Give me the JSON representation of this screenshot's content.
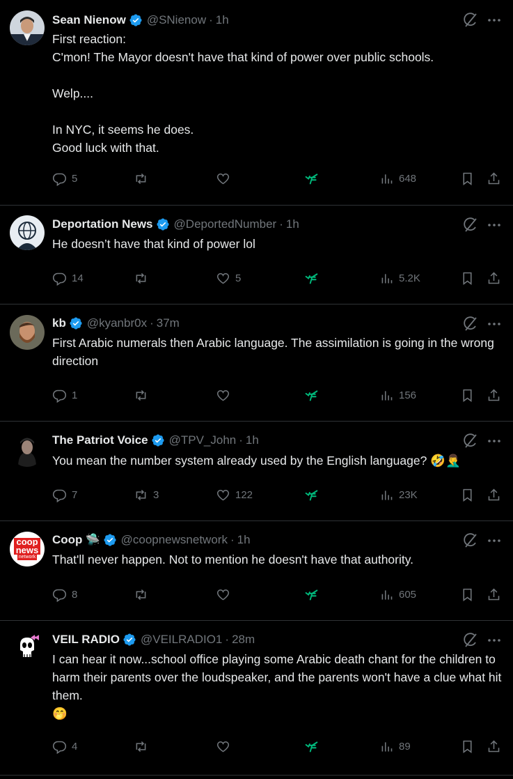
{
  "tweets": [
    {
      "name": "Sean Nienow",
      "handle": "@SNienow",
      "time": "1h",
      "text": "First reaction:\nC'mon! The Mayor doesn't have that kind of power over public schools.\n\nWelp....\n\nIn NYC, it seems he does.\nGood luck with that.",
      "replies": "5",
      "reposts": "",
      "likes": "",
      "views": "648",
      "name_emoji": ""
    },
    {
      "name": "Deportation News",
      "handle": "@DeportedNumber",
      "time": "1h",
      "text": "He doesn’t have that kind of power lol",
      "replies": "14",
      "reposts": "",
      "likes": "5",
      "views": "5.2K",
      "name_emoji": ""
    },
    {
      "name": "kb",
      "handle": "@kyanbr0x",
      "time": "37m",
      "text": "First Arabic numerals then Arabic language. The assimilation is going in the wrong direction",
      "replies": "1",
      "reposts": "",
      "likes": "",
      "views": "156",
      "name_emoji": ""
    },
    {
      "name": "The Patriot Voice",
      "handle": "@TPV_John",
      "time": "1h",
      "text": "You mean the number system already used by the English language? 🤣🤦‍♂️",
      "replies": "7",
      "reposts": "3",
      "likes": "122",
      "views": "23K",
      "name_emoji": ""
    },
    {
      "name": "Coop",
      "handle": "@coopnewsnetwork",
      "time": "1h",
      "text": "That'll never happen. Not to mention he doesn't have that authority.",
      "replies": "8",
      "reposts": "",
      "likes": "",
      "views": "605",
      "name_emoji": "🛸"
    },
    {
      "name": "VEIL RADIO",
      "handle": "@VEILRADIO1",
      "time": "28m",
      "text": "I can hear it now...school office playing some Arabic death chant for the children to harm their parents over the loudspeaker, and the parents won't have a clue what hit them.\n🤭",
      "replies": "4",
      "reposts": "",
      "likes": "",
      "views": "89",
      "name_emoji": ""
    }
  ],
  "avatars": {
    "t1": "person-avatar",
    "t2": "globe-logo-avatar",
    "t3": "bearded-man-avatar",
    "t4": "hooded-man-avatar",
    "t5": "coop-news-network-logo",
    "t6": "skull-bow-logo"
  },
  "coop_logo": {
    "line1": "coop",
    "line2": "news",
    "line3": "network"
  },
  "colors": {
    "background": "#000000",
    "text": "#e7e9ea",
    "muted": "#71767b",
    "verified": "#1d9bf0",
    "divider": "#2f3336",
    "grok": "#00ba7c"
  }
}
